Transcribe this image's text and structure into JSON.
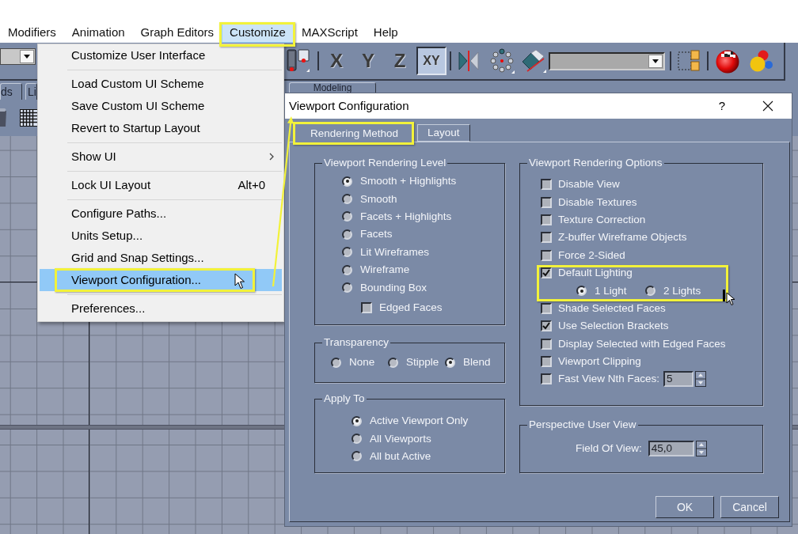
{
  "menu_bar": {
    "items": [
      {
        "label": "Modifiers",
        "selected": false
      },
      {
        "label": "Animation",
        "selected": false
      },
      {
        "label": "Graph Editors",
        "selected": false
      },
      {
        "label": "Customize",
        "selected": true,
        "callout": true
      },
      {
        "label": "MAXScript",
        "selected": false
      },
      {
        "label": "Help",
        "selected": false
      }
    ]
  },
  "toolbar": {
    "axis_buttons": [
      {
        "label": "X",
        "selected": false
      },
      {
        "label": "Y",
        "selected": false
      },
      {
        "label": "Z",
        "selected": false
      },
      {
        "label": "XY",
        "selected": true
      }
    ]
  },
  "command_panel_tabs": [
    {
      "label": "ds",
      "selected": false
    },
    {
      "label": "Li",
      "selected": false
    },
    {
      "label": "Modeling",
      "selected": false
    }
  ],
  "customize_menu": {
    "groups": [
      [
        {
          "label": "Customize User Interface",
          "kind": "command",
          "selected": false
        }
      ],
      [
        {
          "label": "Load Custom UI Scheme",
          "kind": "command",
          "selected": false
        },
        {
          "label": "Save Custom UI Scheme",
          "kind": "command",
          "selected": false
        },
        {
          "label": "Revert to Startup Layout",
          "kind": "command",
          "selected": false
        }
      ],
      [
        {
          "label": "Show UI",
          "kind": "submenu",
          "selected": false
        }
      ],
      [
        {
          "label": "Lock UI Layout",
          "kind": "command",
          "selected": false,
          "shortcut": "Alt+0"
        }
      ],
      [
        {
          "label": "Configure Paths...",
          "kind": "command",
          "selected": false
        },
        {
          "label": "Units Setup...",
          "kind": "command",
          "selected": false
        },
        {
          "label": "Grid and Snap Settings...",
          "kind": "command",
          "selected": false
        },
        {
          "label": "Viewport Configuration...",
          "kind": "command",
          "selected": true,
          "callout": true
        }
      ],
      [
        {
          "label": "Preferences...",
          "kind": "command",
          "selected": false
        }
      ]
    ]
  },
  "dialog": {
    "title": "Viewport Configuration",
    "help": "?",
    "tabs": [
      {
        "label": "Rendering Method",
        "selected": true,
        "callout": true
      },
      {
        "label": "Layout",
        "selected": false
      }
    ],
    "rendering_level": {
      "title": "Viewport Rendering Level",
      "options": [
        {
          "label": "Smooth + Highlights",
          "selected": true
        },
        {
          "label": "Smooth",
          "selected": false
        },
        {
          "label": "Facets + Highlights",
          "selected": false
        },
        {
          "label": "Facets",
          "selected": false
        },
        {
          "label": "Lit Wireframes",
          "selected": false
        },
        {
          "label": "Wireframe",
          "selected": false
        },
        {
          "label": "Bounding Box",
          "selected": false
        }
      ],
      "edged_faces": {
        "label": "Edged Faces",
        "checked": false
      }
    },
    "transparency": {
      "title": "Transparency",
      "options": [
        {
          "label": "None",
          "selected": false
        },
        {
          "label": "Stipple",
          "selected": false
        },
        {
          "label": "Blend",
          "selected": true
        }
      ]
    },
    "apply_to": {
      "title": "Apply To",
      "options": [
        {
          "label": "Active Viewport Only",
          "selected": true
        },
        {
          "label": "All Viewports",
          "selected": false
        },
        {
          "label": "All but Active",
          "selected": false
        }
      ]
    },
    "rendering_options": {
      "title": "Viewport Rendering Options",
      "items": [
        {
          "kind": "checkbox",
          "label": "Disable View",
          "checked": false
        },
        {
          "kind": "checkbox",
          "label": "Disable Textures",
          "checked": false
        },
        {
          "kind": "checkbox",
          "label": "Texture Correction",
          "checked": false
        },
        {
          "kind": "checkbox",
          "label": "Z-buffer Wireframe Objects",
          "checked": false
        },
        {
          "kind": "checkbox",
          "label": "Force 2-Sided",
          "checked": false
        },
        {
          "kind": "choice",
          "label": "Default Lighting",
          "checked": true,
          "callout": true,
          "choices": [
            {
              "label": "1 Light",
              "selected": true
            },
            {
              "label": "2 Lights",
              "selected": false
            }
          ]
        },
        {
          "kind": "checkbox",
          "label": "Shade Selected Faces",
          "checked": false
        },
        {
          "kind": "checkbox",
          "label": "Use Selection Brackets",
          "checked": true
        },
        {
          "kind": "checkbox",
          "label": "Display Selected with Edged Faces",
          "checked": false
        },
        {
          "kind": "checkbox",
          "label": "Viewport Clipping",
          "checked": false
        },
        {
          "kind": "spinner",
          "label": "Fast View Nth Faces:",
          "checked": false,
          "value": "5"
        }
      ]
    },
    "perspective_view": {
      "title": "Perspective User View",
      "field_label": "Field Of View:",
      "value": "45,0"
    },
    "buttons": [
      "OK",
      "Cancel"
    ]
  }
}
